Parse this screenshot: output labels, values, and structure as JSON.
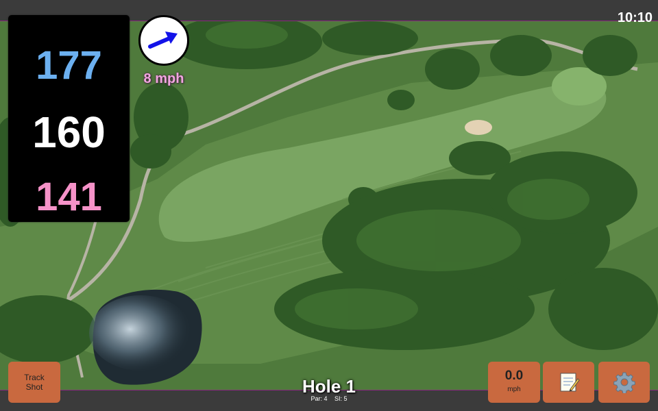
{
  "status": {
    "clock": "10:10"
  },
  "distances": {
    "back": "177",
    "middle": "160",
    "front": "141"
  },
  "wind": {
    "speed_label": "8 mph",
    "icon": "wind-direction-arrow-icon"
  },
  "track_shot": {
    "label_line1": "Track",
    "label_line2": "Shot"
  },
  "hole": {
    "title": "Hole 1",
    "par_label": "Par: 4",
    "si_label": "SI: 5"
  },
  "speed": {
    "value": "0.0",
    "unit": "mph"
  },
  "icons": {
    "notes": "notepad-icon",
    "settings": "gear-icon"
  },
  "colors": {
    "back_distance": "#6cb0f0",
    "middle_distance": "#ffffff",
    "front_distance": "#f592c8",
    "button": "#c9693f",
    "wind_text": "#f2a6e0"
  }
}
